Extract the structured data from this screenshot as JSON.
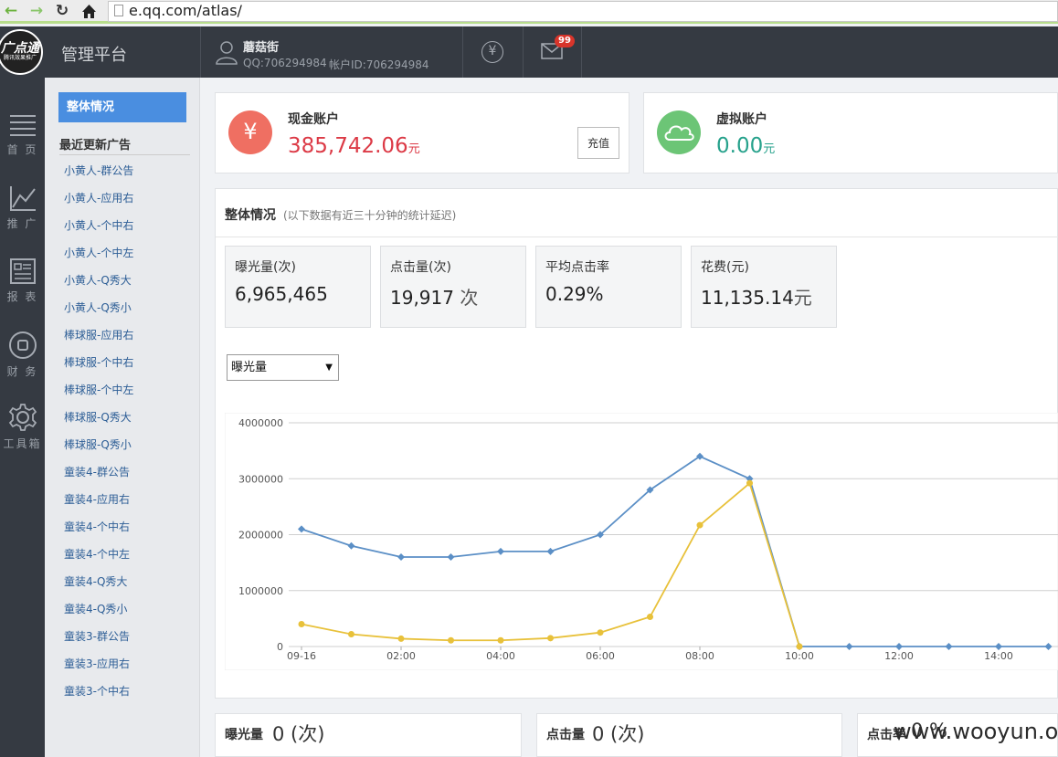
{
  "browser": {
    "url": "e.qq.com/atlas/",
    "back": "←",
    "forward": "→",
    "reload": "↻"
  },
  "header": {
    "logo_text": "广点通",
    "logo_sub": "腾讯效果推广",
    "platform_title": "管理平台",
    "user_name": "蘑菇街",
    "qq": "QQ:706294984",
    "account_id": "帐户ID:706294984",
    "currency_symbol": "¥",
    "mail_count": "99"
  },
  "leftnav": [
    {
      "label": "首 页",
      "icon": "list-icon"
    },
    {
      "label": "推 广",
      "icon": "line-chart-icon"
    },
    {
      "label": "报 表",
      "icon": "report-icon"
    },
    {
      "label": "财 务",
      "icon": "finance-icon"
    },
    {
      "label": "工具箱",
      "icon": "gear-icon"
    }
  ],
  "sidebar": {
    "active": "整体情况",
    "heading": "最近更新广告",
    "items": [
      "小黄人-群公告",
      "小黄人-应用右",
      "小黄人-个中右",
      "小黄人-个中左",
      "小黄人-Q秀大",
      "小黄人-Q秀小",
      "棒球服-应用右",
      "棒球服-个中右",
      "棒球服-个中左",
      "棒球服-Q秀大",
      "棒球服-Q秀小",
      "童装4-群公告",
      "童装4-应用右",
      "童装4-个中右",
      "童装4-个中左",
      "童装4-Q秀大",
      "童装4-Q秀小",
      "童装3-群公告",
      "童装3-应用右",
      "童装3-个中右"
    ]
  },
  "cash": {
    "label": "现金账户",
    "amount": "385,742.06",
    "unit": "元",
    "button": "充值",
    "icon_symbol": "¥",
    "color": "#dc3a46",
    "icon_color": "#ef6f62"
  },
  "virtual": {
    "label": "虚拟账户",
    "amount": "0.00",
    "unit": "元",
    "color": "#27a28c",
    "icon_color": "#6cc576"
  },
  "overview": {
    "title": "整体情况",
    "note": "(以下数据有近三十分钟的统计延迟)",
    "stats": [
      {
        "label": "曝光量(次)",
        "value": "6,965,465",
        "unit": ""
      },
      {
        "label": "点击量(次)",
        "value": "19,917",
        "unit": " 次"
      },
      {
        "label": "平均点击率",
        "value": "0.29%",
        "unit": ""
      },
      {
        "label": "花费(元)",
        "value": "11,135.14",
        "unit": "元"
      }
    ],
    "metric_select": "曝光量"
  },
  "chart_data": {
    "type": "line",
    "x": [
      "09-16",
      "01:00",
      "02:00",
      "03:00",
      "04:00",
      "05:00",
      "06:00",
      "07:00",
      "08:00",
      "09:00",
      "10:00",
      "11:00",
      "12:00",
      "13:00",
      "14:00",
      "15:00"
    ],
    "tick_labels": [
      "09-16",
      "02:00",
      "04:00",
      "06:00",
      "08:00",
      "10:00",
      "12:00",
      "14:00"
    ],
    "y_ticks": [
      "0",
      "1000000",
      "2000000",
      "3000000",
      "4000000"
    ],
    "ylim": [
      0,
      4000000
    ],
    "grid": true,
    "series": [
      {
        "color": "#5b8fc6",
        "values": [
          2100000,
          1800000,
          1600000,
          1600000,
          1700000,
          1700000,
          2000000,
          2800000,
          3400000,
          3000000,
          0,
          0,
          0,
          0,
          0,
          0
        ]
      },
      {
        "color": "#e8c13a",
        "values": [
          400000,
          220000,
          140000,
          110000,
          110000,
          150000,
          250000,
          530000,
          2170000,
          2920000,
          0,
          null,
          null,
          null,
          null,
          null
        ]
      }
    ]
  },
  "bottom": [
    {
      "label": "曝光量",
      "value": "0 (次)"
    },
    {
      "label": "点击量",
      "value": "0 (次)"
    },
    {
      "label": "点击率",
      "value": "0 %"
    }
  ],
  "watermark": "www.wooyun.org"
}
